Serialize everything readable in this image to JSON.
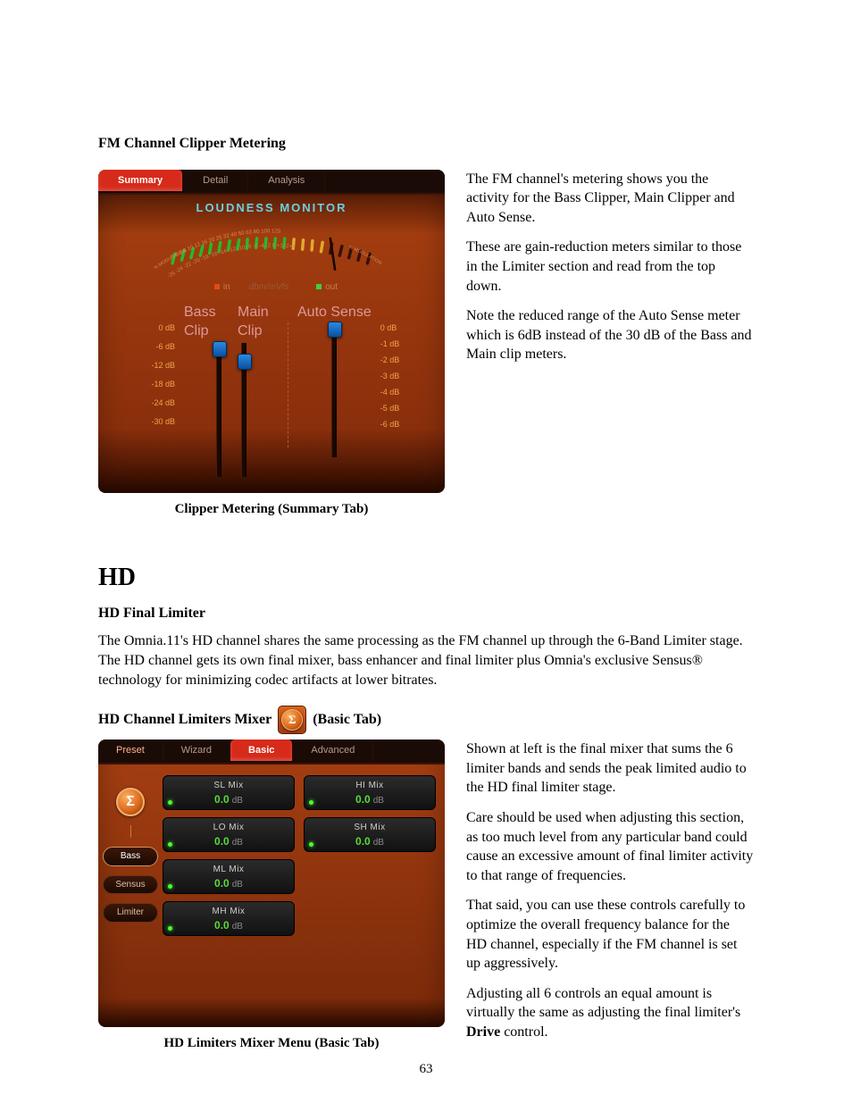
{
  "headings": {
    "fm_metering": "FM Channel Clipper Metering",
    "fm_caption": "Clipper Metering (Summary Tab)",
    "hd": "HD",
    "hd_final": "HD Final Limiter",
    "hd_mixer_pre": "HD Channel Limiters Mixer",
    "hd_mixer_post": " (Basic Tab)",
    "hd_caption": "HD Limiters Mixer Menu (Basic Tab)"
  },
  "body": {
    "fm_p1": "The FM channel's metering shows you the activity for the Bass Clipper, Main Clipper and Auto Sense.",
    "fm_p2": "These are gain-reduction meters similar to those in the Limiter section and read from the top down.",
    "fm_p3": "Note the reduced range of the Auto Sense meter which is 6dB instead of the 30 dB of the Bass and Main clip meters.",
    "hd_intro": "The Omnia.11's HD channel shares the same processing as the FM channel up through the 6-Band Limiter stage. The HD channel gets its own final mixer, bass enhancer and final limiter plus Omnia's exclusive Sensus® technology for minimizing codec artifacts at lower bitrates.",
    "hd_p1": "Shown at left is the final mixer that sums the 6 limiter bands and sends the peak limited audio to the HD final limiter stage.",
    "hd_p2": "Care should be used when adjusting this section, as too much level from any particular band could cause an excessive amount of final limiter activity to that range of frequencies.",
    "hd_p3": "That said, you can use these controls carefully to optimize the overall frequency balance for the HD channel, especially if the FM channel is set up aggressively.",
    "hd_p4_a": "Adjusting all 6 controls an equal amount is virtually the same as adjusting the final limiter's ",
    "hd_p4_b": "Drive",
    "hd_p4_c": " control."
  },
  "panel1": {
    "tabs": {
      "summary": "Summary",
      "detail": "Detail",
      "analysis": "Analysis"
    },
    "lm_title": "LOUDNESS MONITOR",
    "arc_left": "% MODULATION",
    "arc_right": "% MODULATION",
    "arc_top_ticks": [
      "5",
      "6.3",
      "8",
      "10",
      "12",
      "16",
      "20",
      "25",
      "32",
      "40",
      "50",
      "63",
      "80",
      "100",
      "125"
    ],
    "arc_bot_ticks": [
      "-26",
      "-24",
      "-22",
      "-20",
      "-18",
      "-16",
      "-14",
      "-12",
      "-10",
      "-8",
      "-6",
      "-4",
      "-2",
      "0",
      "+1+2+3"
    ],
    "legend_in": "in",
    "legend_mid": "dbm/mVfs",
    "legend_out": "out",
    "labels": {
      "bass": "Bass Clip",
      "main": "Main Clip",
      "auto": "Auto Sense"
    },
    "scale_left": [
      "0 dB",
      "-6 dB",
      "-12 dB",
      "-18 dB",
      "-24 dB",
      "-30 dB"
    ],
    "scale_right": [
      "0 dB",
      "-1 dB",
      "-2 dB",
      "-3 dB",
      "-4 dB",
      "-5 dB",
      "-6 dB"
    ]
  },
  "panel2": {
    "tabs": {
      "preset": "Preset",
      "wizard": "Wizard",
      "basic": "Basic",
      "advanced": "Advanced"
    },
    "nav": {
      "bass": "Bass",
      "sensus": "Sensus",
      "limiter": "Limiter"
    },
    "sigma": "Σ",
    "mix": {
      "sl": {
        "label": "SL Mix",
        "val": "0.0",
        "unit": "dB"
      },
      "hi": {
        "label": "HI Mix",
        "val": "0.0",
        "unit": "dB"
      },
      "lo": {
        "label": "LO Mix",
        "val": "0.0",
        "unit": "dB"
      },
      "sh": {
        "label": "SH Mix",
        "val": "0.0",
        "unit": "dB"
      },
      "ml": {
        "label": "ML Mix",
        "val": "0.0",
        "unit": "dB"
      },
      "mh": {
        "label": "MH Mix",
        "val": "0.0",
        "unit": "dB"
      }
    }
  },
  "pagenum": "63"
}
